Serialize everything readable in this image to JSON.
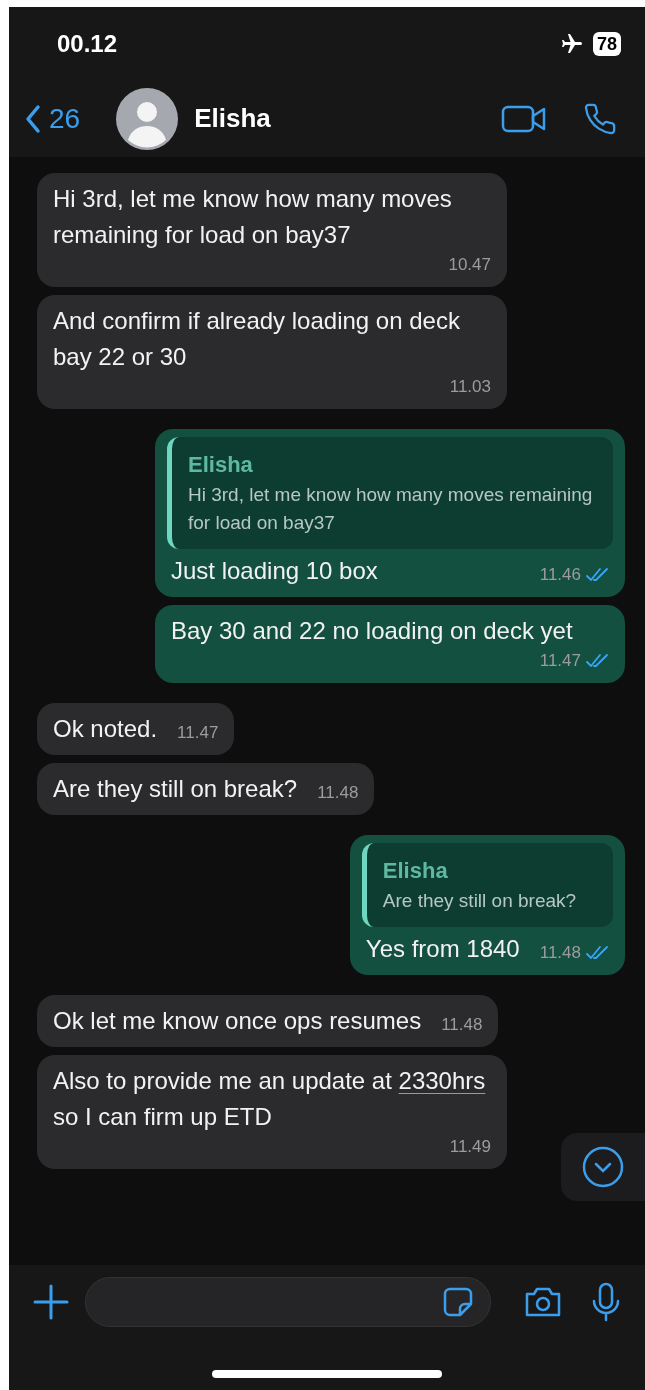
{
  "status_bar": {
    "time": "00.12",
    "airplane_mode": true,
    "battery": "78"
  },
  "header": {
    "back_count": "26",
    "contact_name": "Elisha"
  },
  "messages": [
    {
      "kind": "incoming",
      "parts": [
        {
          "kind": "text",
          "text": "Hi 3rd, let me know how many moves remaining for load on bay37"
        }
      ],
      "time": "10.47"
    },
    {
      "kind": "incoming",
      "parts": [
        {
          "kind": "text",
          "text": "And confirm if already loading on deck bay 22 or 30"
        }
      ],
      "time": "11.03"
    },
    {
      "kind": "outgoing",
      "reply": {
        "author": "Elisha",
        "text": "Hi 3rd, let me know how many moves remaining for load on bay37"
      },
      "parts": [
        {
          "kind": "text",
          "text": "Just loading 10 box"
        }
      ],
      "time": "11.46",
      "read": true
    },
    {
      "kind": "outgoing",
      "parts": [
        {
          "kind": "text",
          "text": "Bay 30 and 22 no loading on deck yet"
        }
      ],
      "time": "11.47",
      "read": true
    },
    {
      "kind": "incoming",
      "parts": [
        {
          "kind": "text",
          "text": "Ok noted."
        }
      ],
      "time": "11.47"
    },
    {
      "kind": "incoming",
      "parts": [
        {
          "kind": "text",
          "text": "Are they still on break?"
        }
      ],
      "time": "11.48"
    },
    {
      "kind": "outgoing",
      "reply": {
        "author": "Elisha",
        "text": "Are they still on break?"
      },
      "parts": [
        {
          "kind": "text",
          "text": "Yes from 1840"
        }
      ],
      "time": "11.48",
      "read": true
    },
    {
      "kind": "incoming",
      "parts": [
        {
          "kind": "text",
          "text": "Ok let me know once ops resumes"
        }
      ],
      "time": "11.48"
    },
    {
      "kind": "incoming",
      "parts": [
        {
          "kind": "text",
          "text": "Also to provide me an update at "
        },
        {
          "kind": "link",
          "text": "2330hrs"
        },
        {
          "kind": "text",
          "text": " so I can firm up ETD"
        }
      ],
      "time": "11.49"
    }
  ]
}
